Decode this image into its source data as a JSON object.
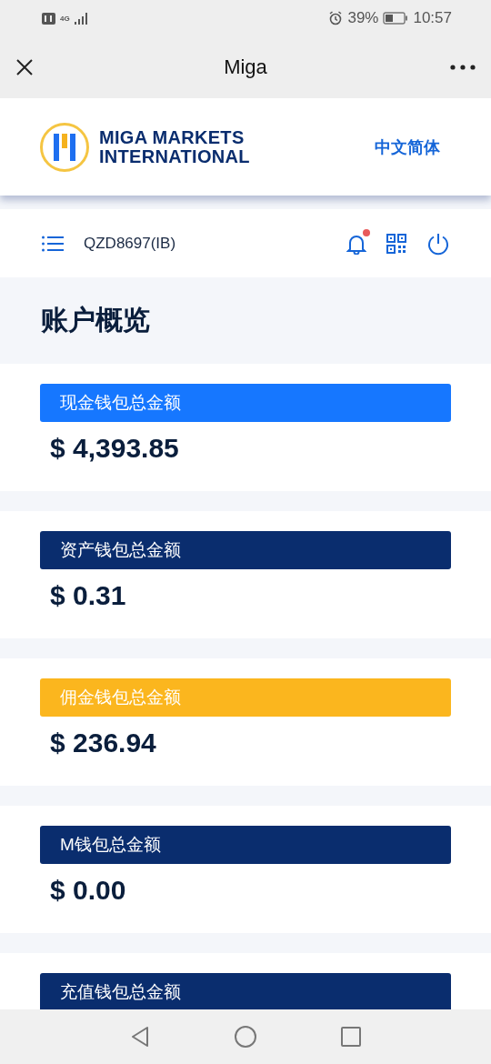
{
  "status_bar": {
    "network": "4G",
    "battery": "39%",
    "time": "10:57"
  },
  "title_bar": {
    "title": "Miga"
  },
  "header": {
    "logo_line_1": "MIGA MARKETS",
    "logo_line_2": "INTERNATIONAL",
    "language": "中文简体"
  },
  "toolbar": {
    "account": "QZD8697(IB)",
    "unread": true
  },
  "page_title": "账户概览",
  "wallets": [
    {
      "label": "现金钱包总金额",
      "amount": "$ 4,393.85",
      "color": "#1677ff"
    },
    {
      "label": "资产钱包总金额",
      "amount": "$ 0.31",
      "color": "#0a2d6e"
    },
    {
      "label": "佣金钱包总金额",
      "amount": "$ 236.94",
      "color": "#fbb61e"
    },
    {
      "label": "M钱包总金额",
      "amount": "$ 0.00",
      "color": "#0a2d6e"
    },
    {
      "label": "充值钱包总金额",
      "color": "#0a2d6e"
    }
  ]
}
